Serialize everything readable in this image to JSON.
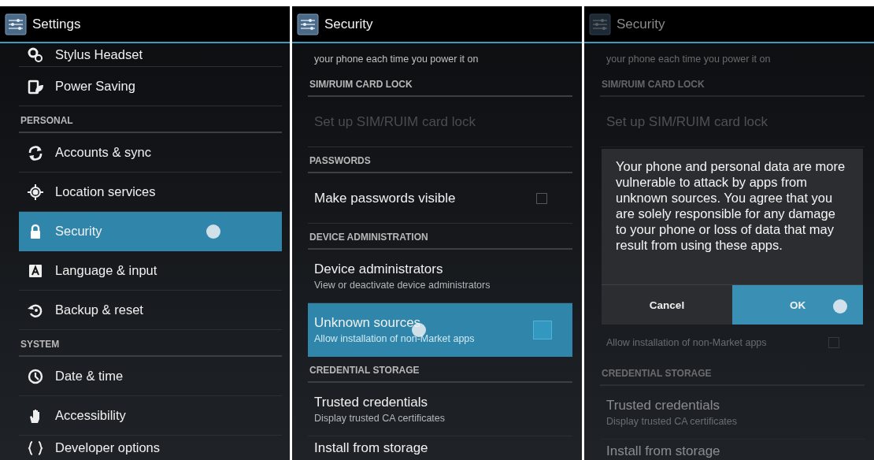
{
  "screens": [
    {
      "title": "Settings",
      "dimmed": false,
      "list": [
        {
          "kind": "item",
          "title": "Stylus Headset",
          "selected": false,
          "touch": false
        },
        {
          "kind": "item",
          "title": "Power Saving",
          "selected": false,
          "touch": false
        },
        {
          "kind": "header",
          "title": "PERSONAL"
        },
        {
          "kind": "item",
          "title": "Accounts & sync",
          "selected": false,
          "touch": false
        },
        {
          "kind": "item",
          "title": "Location services",
          "selected": false,
          "touch": false
        },
        {
          "kind": "item",
          "title": "Security",
          "selected": true,
          "touch": true
        },
        {
          "kind": "item",
          "title": "Language & input",
          "selected": false,
          "touch": false
        },
        {
          "kind": "item",
          "title": "Backup & reset",
          "selected": false,
          "touch": false
        },
        {
          "kind": "header",
          "title": "SYSTEM"
        },
        {
          "kind": "item",
          "title": "Date & time",
          "selected": false,
          "touch": false
        },
        {
          "kind": "item",
          "title": "Accessibility",
          "selected": false,
          "touch": false
        },
        {
          "kind": "item",
          "title": "Developer options",
          "selected": false,
          "touch": false
        }
      ]
    },
    {
      "title": "Security",
      "dimmed": false,
      "list": [
        {
          "kind": "summary",
          "text": "your phone each time you power it on"
        },
        {
          "kind": "header",
          "title": "SIM/RUIM CARD LOCK"
        },
        {
          "kind": "item",
          "title": "Set up SIM/RUIM card lock",
          "disabled": true,
          "pressed": false,
          "touch": false
        },
        {
          "kind": "header",
          "title": "PASSWORDS"
        },
        {
          "kind": "check",
          "title": "Make passwords visible",
          "checked": false,
          "disabled": false,
          "pressed": false,
          "touch": false
        },
        {
          "kind": "header",
          "title": "DEVICE ADMINISTRATION"
        },
        {
          "kind": "item",
          "title": "Device administrators",
          "summary": "View or deactivate device administrators",
          "disabled": false,
          "pressed": false,
          "touch": false
        },
        {
          "kind": "check",
          "title": "Unknown sources",
          "summary": "Allow installation of non-Market apps",
          "checked": false,
          "disabled": false,
          "pressed": true,
          "touch": true
        },
        {
          "kind": "header",
          "title": "CREDENTIAL STORAGE"
        },
        {
          "kind": "item",
          "title": "Trusted credentials",
          "summary": "Display trusted CA certificates",
          "disabled": false,
          "pressed": false,
          "touch": false
        },
        {
          "kind": "item",
          "title": "Install from storage",
          "disabled": false,
          "pressed": false,
          "touch": false
        }
      ]
    },
    {
      "title": "Security",
      "dimmed": true,
      "list": [
        {
          "kind": "summary",
          "text": "your phone each time you power it on"
        },
        {
          "kind": "header",
          "title": "SIM/RUIM CARD LOCK"
        },
        {
          "kind": "item",
          "title": "Set up SIM/RUIM card lock",
          "disabled": true,
          "pressed": false,
          "touch": false
        },
        {
          "kind": "dialog",
          "message": "Your phone and personal data are more vulnerable to attack by apps from unknown sources. You agree that you are solely responsible for any damage to your phone or loss of data that may result from using these apps.",
          "buttons": [
            {
              "label": "Cancel",
              "selected": false,
              "touch": false
            },
            {
              "label": "OK",
              "selected": true,
              "touch": true
            }
          ]
        },
        {
          "kind": "check",
          "summary": "Allow installation of non-Market apps",
          "checked": false,
          "disabled": false,
          "pressed": false,
          "touch": false
        },
        {
          "kind": "header",
          "title": "CREDENTIAL STORAGE"
        },
        {
          "kind": "item",
          "title": "Trusted credentials",
          "summary": "Display trusted CA certificates",
          "disabled": false,
          "pressed": false,
          "touch": false
        },
        {
          "kind": "item",
          "title": "Install from storage",
          "disabled": false,
          "pressed": false,
          "touch": false
        }
      ]
    }
  ]
}
